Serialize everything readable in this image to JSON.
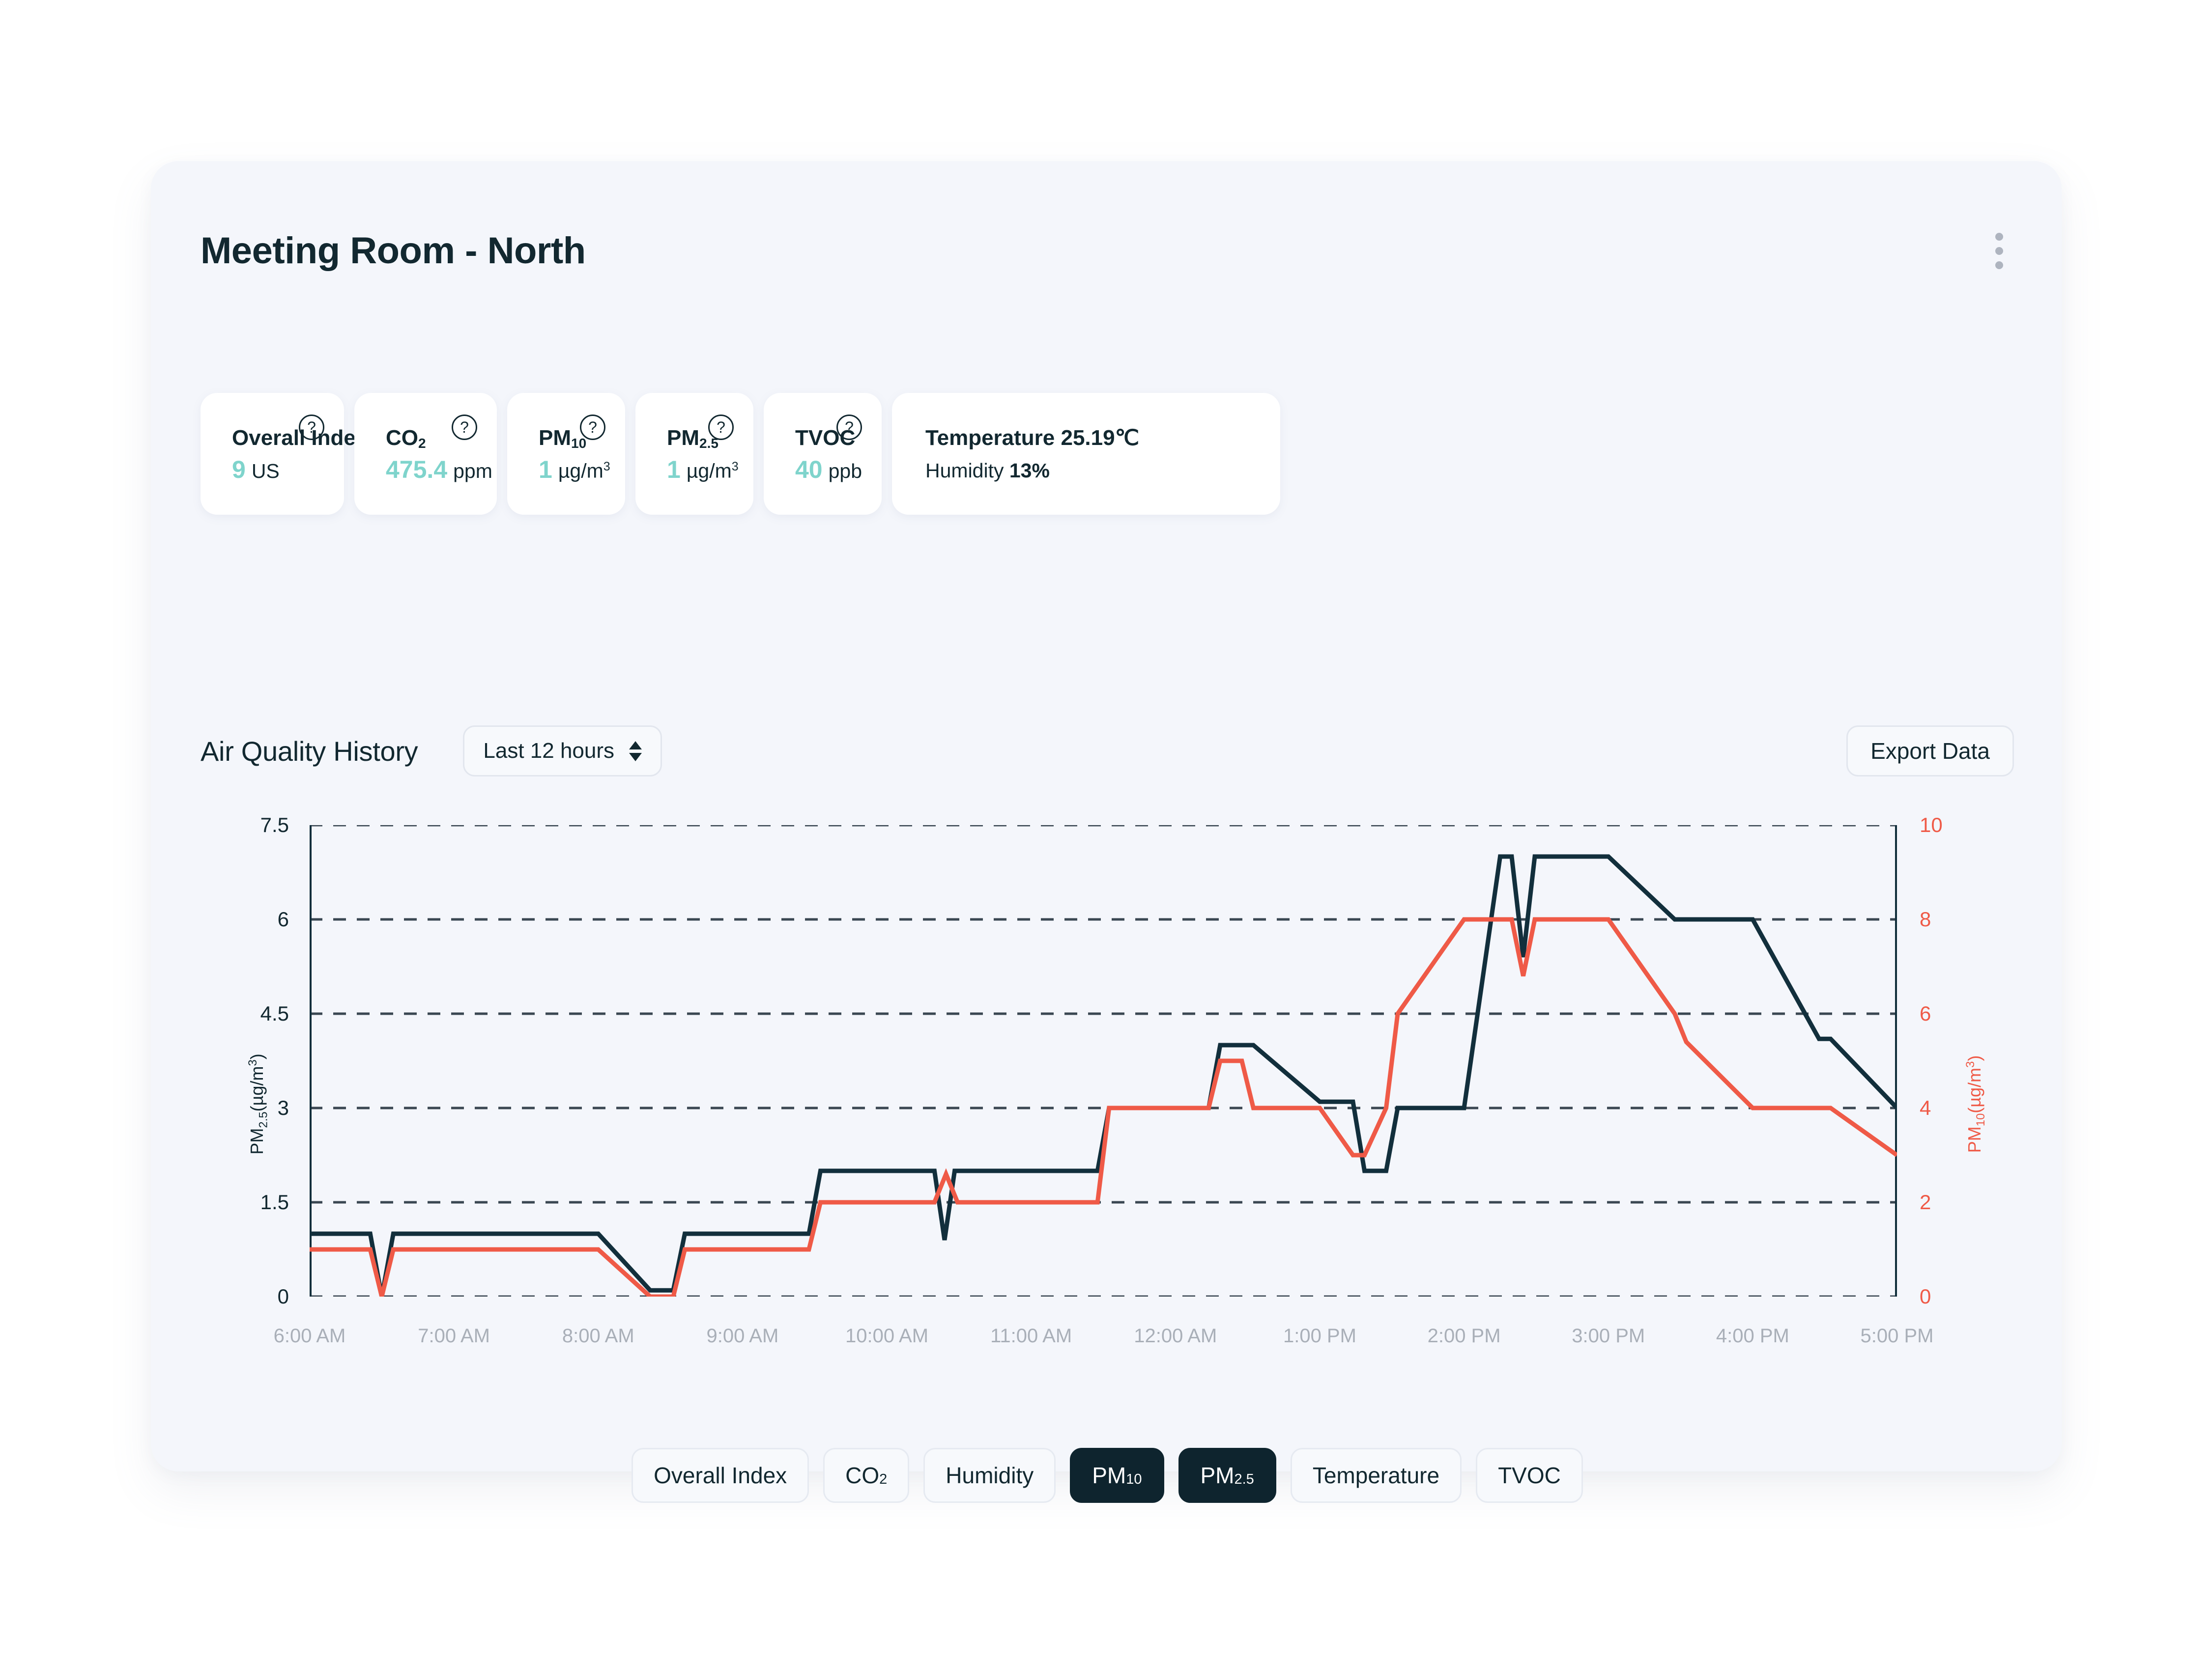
{
  "header": {
    "title": "Meeting Room - North",
    "menu_icon": "kebab-menu-icon"
  },
  "metrics": [
    {
      "label": "Overall Index",
      "label_sub": "",
      "value": "9",
      "unit": "US",
      "help": "?"
    },
    {
      "label": "CO",
      "label_sub": "2",
      "value": "475.4",
      "unit": "ppm",
      "help": "?"
    },
    {
      "label": "PM",
      "label_sub": "10",
      "value": "1",
      "unit": "µg/m",
      "unit_sup": "3",
      "help": "?"
    },
    {
      "label": "PM",
      "label_sub": "2.5",
      "value": "1",
      "unit": "µg/m",
      "unit_sup": "3",
      "help": "?"
    },
    {
      "label": "TVOC",
      "label_sub": "",
      "value": "40",
      "unit": "ppb",
      "help": "?"
    }
  ],
  "environment": {
    "temperature_line": "Temperature 25.19℃",
    "humidity_label": "Humidity ",
    "humidity_value": "13%"
  },
  "chart_section": {
    "title": "Air Quality History",
    "range_value": "Last 12 hours",
    "range_icon": "up-down-chevron-icon",
    "export_label": "Export Data"
  },
  "legend": [
    {
      "label": "Overall Index",
      "sub": "",
      "active": false
    },
    {
      "label": "CO",
      "sub": "2",
      "active": false
    },
    {
      "label": "Humidity",
      "sub": "",
      "active": false
    },
    {
      "label": "PM",
      "sub": "10",
      "active": true
    },
    {
      "label": "PM",
      "sub": "2.5",
      "active": true
    },
    {
      "label": "Temperature",
      "sub": "",
      "active": false
    },
    {
      "label": "TVOC",
      "sub": "",
      "active": false
    }
  ],
  "colors": {
    "accent_teal": "#7FD4CC",
    "ink": "#122830",
    "pm25_line": "#122F3C",
    "pm10_line": "#EF5A47",
    "panel_bg": "#F4F6FB",
    "card_bg": "#FFFFFF",
    "tick_gray": "#A9AFB8"
  },
  "chart_data": {
    "type": "line",
    "title": "Air Quality History",
    "xlabel": "",
    "grid": true,
    "legend_position": "bottom",
    "x_ticks": [
      "6:00 AM",
      "7:00 AM",
      "8:00 AM",
      "9:00 AM",
      "10:00 AM",
      "11:00 AM",
      "12:00 AM",
      "1:00 PM",
      "2:00 PM",
      "3:00 PM",
      "4:00 PM",
      "5:00 PM"
    ],
    "axes": {
      "left": {
        "label": "PM2.5 (µg/m³)",
        "ticks": [
          0,
          1.5,
          3,
          4.5,
          6,
          7.5
        ],
        "ylim": [
          0,
          7.5
        ],
        "color": "#122830"
      },
      "right": {
        "label": "PM10 (µg/m³)",
        "ticks": [
          0,
          2,
          4,
          6,
          8,
          10
        ],
        "ylim": [
          0,
          10
        ],
        "color": "#EF5A47"
      }
    },
    "series": [
      {
        "name": "PM2.5",
        "axis": "left",
        "color": "#122F3C",
        "x": [
          0.0,
          0.42,
          0.5,
          0.58,
          1.0,
          1.46,
          2.0,
          2.36,
          2.44,
          2.52,
          2.6,
          3.0,
          3.46,
          3.54,
          4.0,
          4.33,
          4.4,
          4.47,
          4.54,
          5.0,
          5.46,
          5.54,
          6.0,
          6.23,
          6.31,
          6.46,
          6.54,
          7.0,
          7.23,
          7.31,
          7.46,
          7.54,
          8.0,
          8.25,
          8.33,
          8.41,
          8.49,
          8.57,
          9.0,
          9.46,
          9.54,
          10.0,
          10.46,
          10.54,
          11.0
        ],
        "y": [
          1.0,
          1.0,
          0.0,
          1.0,
          1.0,
          1.0,
          1.0,
          0.1,
          0.1,
          0.1,
          1.0,
          1.0,
          1.0,
          2.0,
          2.0,
          2.0,
          0.9,
          2.0,
          2.0,
          2.0,
          2.0,
          3.0,
          3.0,
          3.0,
          4.0,
          4.0,
          4.0,
          3.1,
          3.1,
          2.0,
          2.0,
          3.0,
          3.0,
          7.0,
          7.0,
          5.4,
          7.0,
          7.0,
          7.0,
          6.0,
          6.0,
          6.0,
          4.1,
          4.1,
          3.0
        ]
      },
      {
        "name": "PM10",
        "axis": "right",
        "color": "#EF5A47",
        "x": [
          0.0,
          0.42,
          0.5,
          0.58,
          1.0,
          1.46,
          2.0,
          2.36,
          2.44,
          2.52,
          2.6,
          3.0,
          3.46,
          3.54,
          4.0,
          4.33,
          4.41,
          4.49,
          4.57,
          5.0,
          5.46,
          5.54,
          6.0,
          6.23,
          6.31,
          6.46,
          6.54,
          7.0,
          7.23,
          7.31,
          7.46,
          7.54,
          8.0,
          8.25,
          8.33,
          8.41,
          8.49,
          8.57,
          9.0,
          9.46,
          9.54,
          10.0,
          10.46,
          10.54,
          11.0
        ],
        "y": [
          1.0,
          1.0,
          0.0,
          1.0,
          1.0,
          1.0,
          1.0,
          0.0,
          0.0,
          0.0,
          1.0,
          1.0,
          1.0,
          2.0,
          2.0,
          2.0,
          2.6,
          2.0,
          2.0,
          2.0,
          2.0,
          4.0,
          4.0,
          4.0,
          5.0,
          5.0,
          4.0,
          4.0,
          3.0,
          3.0,
          4.0,
          6.0,
          8.0,
          8.0,
          8.0,
          6.8,
          8.0,
          8.0,
          8.0,
          6.0,
          5.4,
          4.0,
          4.0,
          4.0,
          3.0
        ]
      }
    ]
  }
}
